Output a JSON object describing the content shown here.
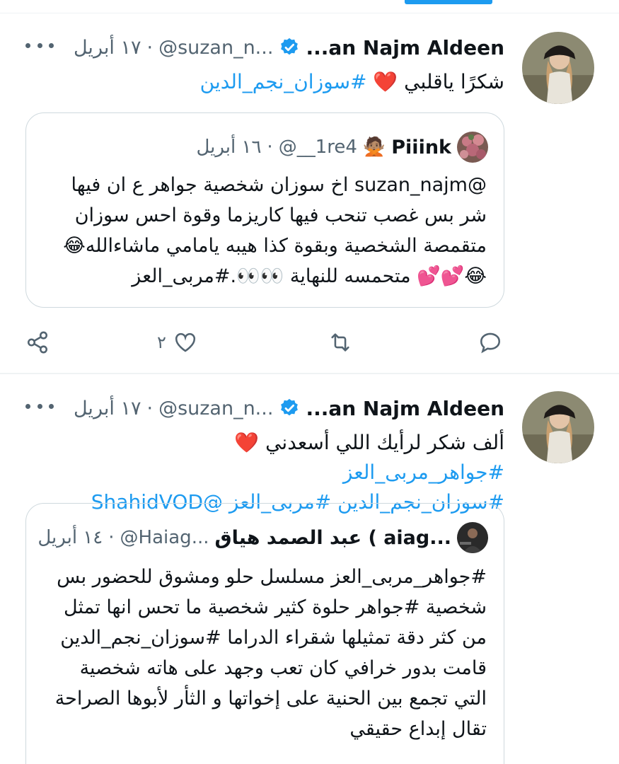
{
  "tweets": [
    {
      "author": {
        "name": "...an Najm Aldeen",
        "handle": "@suzan_n...",
        "date": "١٧ أبريل"
      },
      "text": {
        "plain": "شكرًا ياقلبي ",
        "heart": "❤️",
        "tag": " #سوزان_نجم_الدين"
      },
      "quote": {
        "author": {
          "name": "Piiink",
          "emoji": "🙅🏽",
          "handle": "@__1re4",
          "date": "١٦ أبريل"
        },
        "lines": [
          "@suzan_najm اخ سوزان شخصية جواهر ع ان فيها",
          "شر بس غصب تنحب فيها كاريزما وقوة احس سوزان",
          "متقمصة الشخصية وبقوة كذا هيبه يامامي ماشاءالله😂",
          "😂💕💕 متحمسه للنهاية 👀👀.#مربى_العز"
        ]
      },
      "actions": {
        "like_count": "٢"
      }
    },
    {
      "author": {
        "name": "...an Najm Aldeen",
        "handle": "@suzan_n...",
        "date": "١٧ أبريل"
      },
      "text": {
        "line1_plain": "ألف شكر لرأيك اللي أسعدني ",
        "line1_heart": "❤️",
        "line1_tag": " #جواهر_مربى_العز",
        "line2_tags": "#سوزان_نجم_الدين #مربى_العز @ShahidVOD"
      },
      "quote": {
        "author": {
          "name": "عبد الصمد هياق ( aiag...",
          "handle": "@Haiag...",
          "date": "١٤ أبريل"
        },
        "lines": [
          "#جواهر_مربى_العز مسلسل حلو ومشوق للحضور بس",
          "شخصية #جواهر  حلوة كثير شخصية ما تحس انها تمثل",
          "من كثر دقة تمثيلها شقراء الدراما #سوزان_نجم_الدين",
          "قامت بدور خرافي كان تعب وجهد على هاته شخصية",
          "التي تجمع بين الحنية على إخواتها و الثأر لأبوها الصراحة",
          "تقال إبداع حقيقي"
        ]
      }
    }
  ],
  "colors": {
    "accent": "#1d9bf0",
    "text": "#0f1419",
    "muted": "#536471",
    "border": "#cfd9de",
    "heart": "#e0245e"
  },
  "icons": [
    "more-icon",
    "verified-badge-icon",
    "share-icon",
    "like-icon",
    "retweet-icon",
    "reply-icon"
  ]
}
